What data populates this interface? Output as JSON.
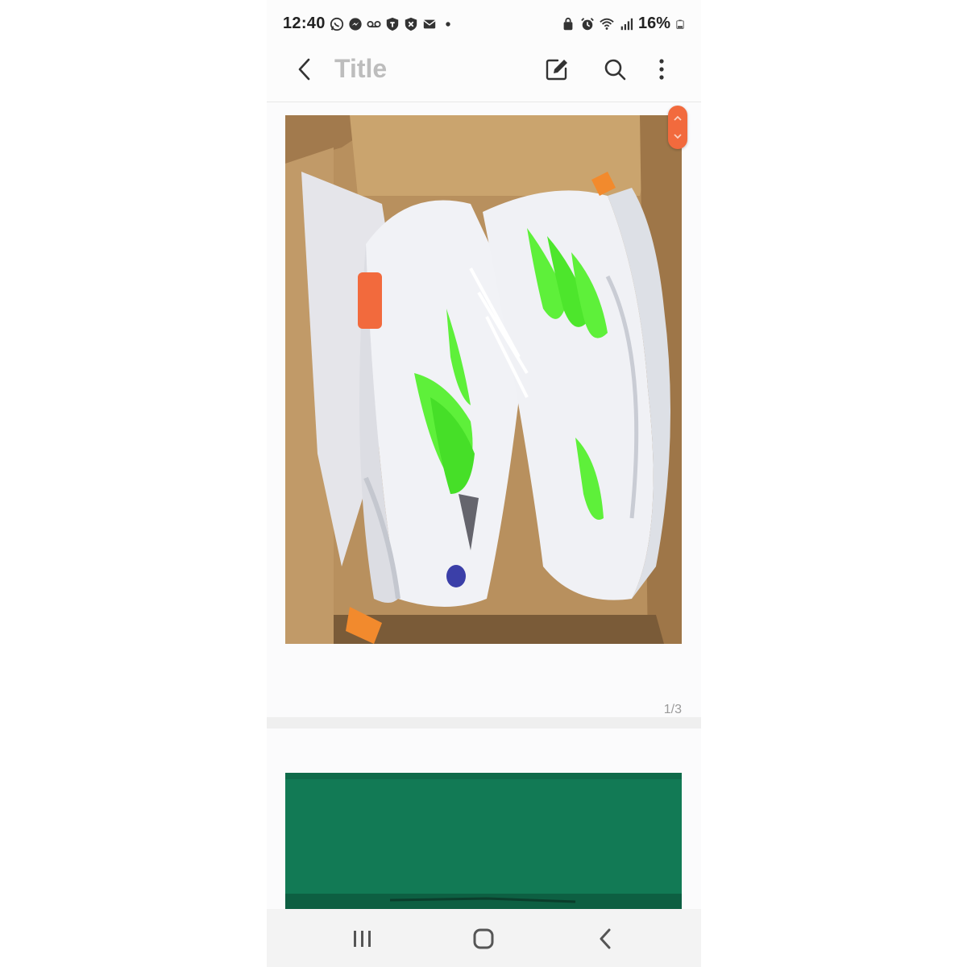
{
  "status_bar": {
    "time": "12:40",
    "battery_percent": "16%",
    "left_icons": [
      "whatsapp-icon",
      "messenger-icon",
      "voicemail-icon",
      "shield-icon",
      "shield-x-icon",
      "mail-icon",
      "dot-icon"
    ],
    "right_icons": [
      "alarm-lock-icon",
      "alarm-icon",
      "wifi-icon",
      "signal-icon",
      "battery-icon"
    ]
  },
  "app_bar": {
    "title": "Title",
    "icons": [
      "back-arrow-icon",
      "edit-icon",
      "search-icon",
      "more-vert-icon"
    ]
  },
  "gallery": {
    "counter": "1/3",
    "photo1_desc_icon": "shoe-photo",
    "photo2_desc_icon": "green-box-photo"
  },
  "nav_bar": {
    "icons": [
      "recents-icon",
      "home-icon",
      "back-icon"
    ]
  },
  "colors": {
    "accent_orange": "#f26a3d",
    "title_grey": "#bdbdbd",
    "box_green": "#127a55",
    "neon_green": "#5ef03a"
  }
}
